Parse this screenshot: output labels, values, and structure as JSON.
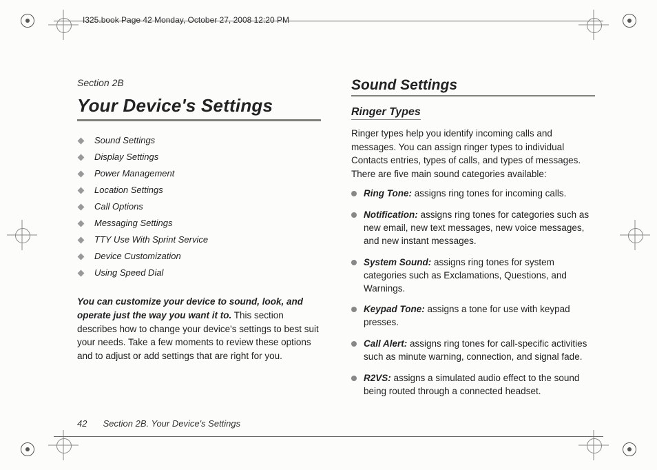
{
  "header": {
    "crop_label": "I325.book  Page 42  Monday, October 27, 2008  12:20 PM"
  },
  "left": {
    "section_label": "Section 2B",
    "title": "Your Device's Settings",
    "toc": [
      "Sound Settings",
      "Display Settings",
      "Power Management",
      "Location Settings",
      "Call Options",
      "Messaging Settings",
      "TTY Use With Sprint Service",
      "Device Customization",
      "Using Speed Dial"
    ],
    "intro_lead": "You can customize your device to sound, look, and operate just the way you want it to.",
    "intro_rest": " This section describes how to change your device's settings to best suit your needs. Take a few moments to review these options and to adjust or add settings that are right for you."
  },
  "right": {
    "h2": "Sound Settings",
    "h3": "Ringer Types",
    "para": "Ringer types help you identify incoming calls and messages. You can assign ringer types to individual Contacts entries, types of calls, and types of messages. There are five main sound categories available:",
    "items": [
      {
        "term": "Ring Tone:",
        "desc": " assigns ring tones for incoming calls."
      },
      {
        "term": "Notification:",
        "desc": " assigns ring tones for categories such as new email, new text messages, new voice messages, and new instant messages."
      },
      {
        "term": "System Sound:",
        "desc": " assigns ring tones for system categories such as Exclamations, Questions, and Warnings."
      },
      {
        "term": "Keypad Tone:",
        "desc": " assigns a tone for use with keypad presses."
      },
      {
        "term": "Call Alert:",
        "desc": " assigns ring tones for call-specific activities such as minute warning, connection, and signal fade."
      },
      {
        "term": "R2VS:",
        "desc": " assigns a simulated audio effect to the sound being routed through a connected headset."
      }
    ]
  },
  "footer": {
    "page_number": "42",
    "running": "Section 2B. Your Device's Settings"
  }
}
